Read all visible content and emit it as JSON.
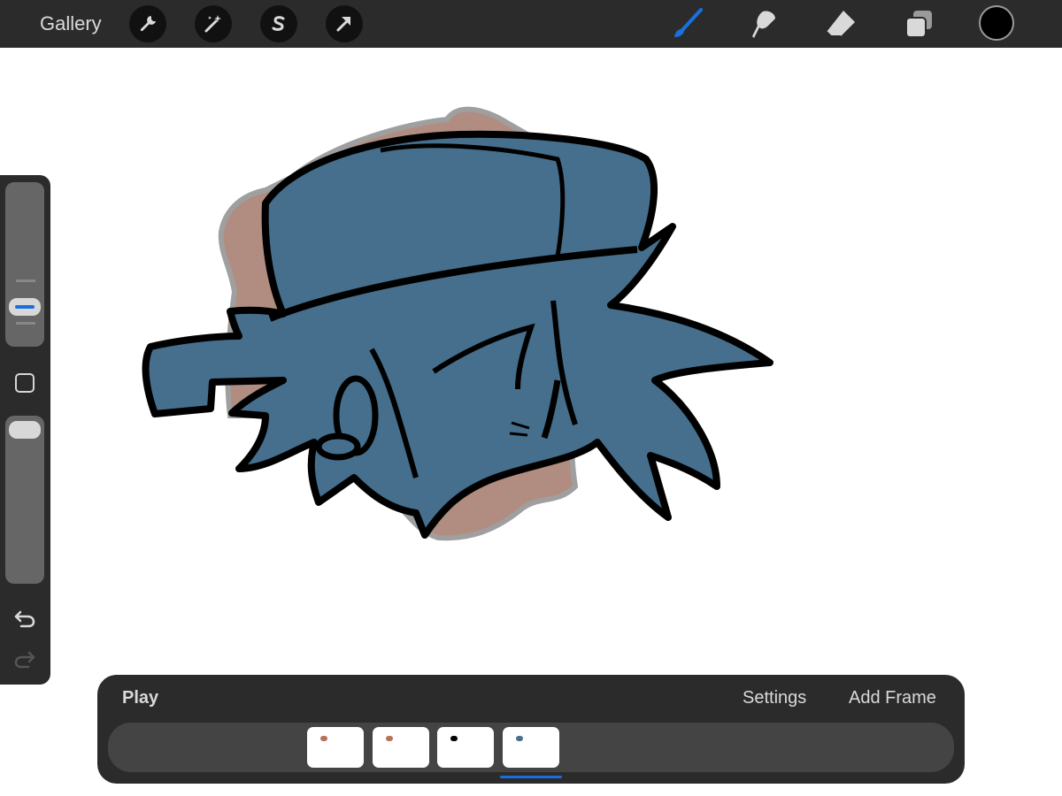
{
  "topbar": {
    "gallery_label": "Gallery",
    "left_tools": [
      {
        "name": "wrench-icon"
      },
      {
        "name": "magic-wand-icon"
      },
      {
        "name": "selection-icon"
      },
      {
        "name": "transform-arrow-icon"
      }
    ],
    "right_tools": [
      {
        "name": "brush-icon",
        "active": true
      },
      {
        "name": "smudge-icon",
        "active": false
      },
      {
        "name": "eraser-icon",
        "active": false
      },
      {
        "name": "layers-icon",
        "active": false
      }
    ],
    "current_color": "#000000"
  },
  "sidebar": {
    "brush_size_level": 0.4,
    "opacity_level": 1.0
  },
  "animation": {
    "play_label": "Play",
    "settings_label": "Settings",
    "add_frame_label": "Add Frame",
    "frames": [
      {
        "thumb_color": "#b5735a"
      },
      {
        "thumb_color": "#b5735a"
      },
      {
        "thumb_color": "#000000"
      },
      {
        "thumb_color": "#4b6f8a"
      }
    ],
    "selected_frame": 4
  },
  "colors": {
    "accent": "#1a6fe0",
    "ui_dark": "#2b2b2b",
    "hat_blue": "#456f8c",
    "onion_brown": "#a4786a"
  }
}
